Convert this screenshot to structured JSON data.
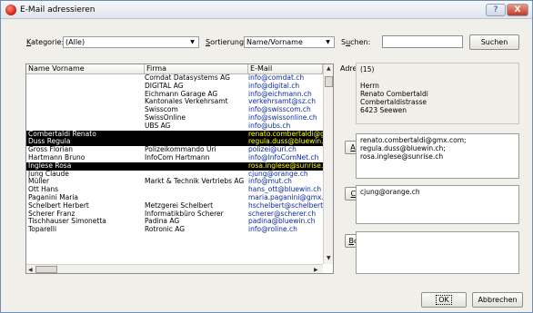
{
  "window": {
    "title": "E-Mail adressieren",
    "help_label": "?",
    "close_label": "X"
  },
  "filters": {
    "kategorie_label": "Kategorie:",
    "kategorie_value": "(Alle)",
    "sortierung_label": "Sortierung:",
    "sortierung_value": "Name/Vorname",
    "suchen_label": "Suchen:",
    "suchen_value": "",
    "suchen_button": "Suchen"
  },
  "list": {
    "columns": [
      "Name Vorname",
      "Firma",
      "E-Mail"
    ],
    "rows": [
      {
        "name": "",
        "firma": "Comdat Datasystems AG",
        "email": "info@comdat.ch",
        "selected": false
      },
      {
        "name": "",
        "firma": "DIGITAL AG",
        "email": "info@digital.ch",
        "selected": false
      },
      {
        "name": "",
        "firma": "Eichmann Garage AG",
        "email": "info@eichmann.ch",
        "selected": false
      },
      {
        "name": "",
        "firma": "Kantonales Verkehrsamt",
        "email": "verkehrsamt@sz.ch",
        "selected": false
      },
      {
        "name": "",
        "firma": "Swisscom",
        "email": "info@swisscom.ch",
        "selected": false
      },
      {
        "name": "",
        "firma": "SwissOnline",
        "email": "info@swissonline.ch",
        "selected": false
      },
      {
        "name": "",
        "firma": "UBS AG",
        "email": "info@ubs.ch",
        "selected": false
      },
      {
        "name": "Combertaldi Renato",
        "firma": "",
        "email": "renato.combertaldi@gm",
        "selected": true
      },
      {
        "name": "Duss Regula",
        "firma": "",
        "email": "regula.duss@bluewin.c",
        "selected": true
      },
      {
        "name": "Gross Florian",
        "firma": "Polizeikommando Uri",
        "email": "polizei@uri.ch",
        "selected": false
      },
      {
        "name": "Hartmann Bruno",
        "firma": "InfoCom Hartmann",
        "email": "info@InfoComNet.ch",
        "selected": false
      },
      {
        "name": "Inglese Rosa",
        "firma": "",
        "email": "rosa.inglese@sunrise.c",
        "selected": true
      },
      {
        "name": "Jung Claude",
        "firma": "",
        "email": "cjung@orange.ch",
        "selected": false
      },
      {
        "name": "Müller",
        "firma": "Markt & Technik Vertriebs AG",
        "email": "info@mut.ch",
        "selected": false
      },
      {
        "name": "Ott Hans",
        "firma": "",
        "email": "hans_ott@bluewin.ch",
        "selected": false
      },
      {
        "name": "Paganini Maria",
        "firma": "",
        "email": "maria.paganini@gmx.cc",
        "selected": false
      },
      {
        "name": "Schelbert Herbert",
        "firma": "Metzgerei Schelbert",
        "email": "hschelbert@schelbert.c",
        "selected": false
      },
      {
        "name": "Scherer Franz",
        "firma": "Informatikbüro Scherer",
        "email": "scherer@scherer.ch",
        "selected": false
      },
      {
        "name": "Tischhauser Simonetta",
        "firma": "Padina AG",
        "email": "padina@bluewin.ch",
        "selected": false
      },
      {
        "name": "Toparelli",
        "firma": "Rotronic AG",
        "email": "info@roline.ch",
        "selected": false
      }
    ]
  },
  "address": {
    "label": "Adresse:",
    "lines": [
      "(15)",
      "",
      "Herrn",
      "Renato Combertaldi",
      "Combertaldistrasse",
      "6423 Seewen"
    ]
  },
  "an": {
    "button": "An: ->",
    "lines": [
      "renato.combertaldi@gmx.com;",
      "regula.duss@bluewin.ch;",
      "rosa.inglese@sunrise.ch"
    ]
  },
  "cc": {
    "button": "Cc: ->",
    "lines": [
      "cjung@orange.ch"
    ]
  },
  "bcc": {
    "button": "Bcc: ->",
    "lines": []
  },
  "footer": {
    "ok": "OK",
    "cancel": "Abbrechen"
  },
  "colors": {
    "selection_bg": "#000000",
    "selection_email": "#ffff00",
    "email_text": "#0a2a9e"
  }
}
